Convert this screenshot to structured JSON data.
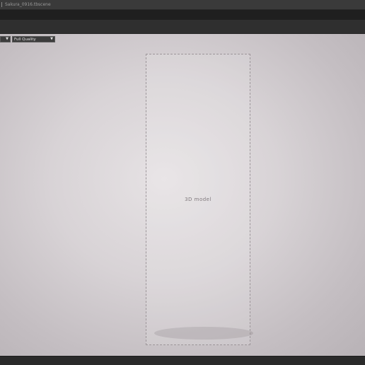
{
  "window": {
    "title": "Sakura_0916.tbscene"
  },
  "viewport": {
    "left_dropdown_arrow": "▼",
    "quality_dropdown": {
      "value": "Full Quality",
      "arrow": "▼"
    },
    "background_color": "#d8d3d6"
  },
  "icons": {
    "title_separator": "separator-icon",
    "dropdown_arrow": "chevron-down-icon"
  }
}
